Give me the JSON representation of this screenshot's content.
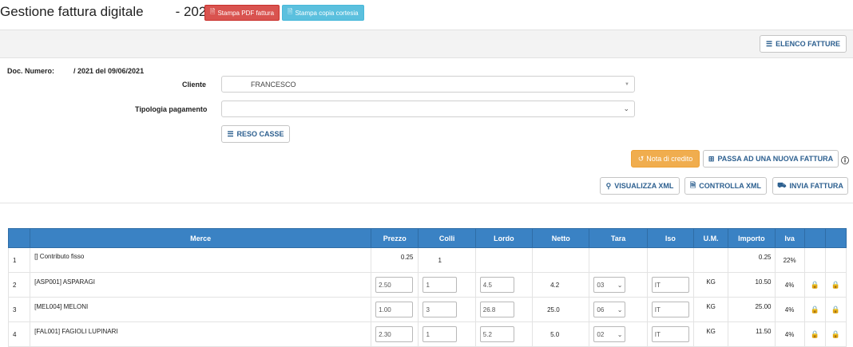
{
  "header": {
    "title": "Gestione fattura digitale",
    "year": "- 2021",
    "pdf_button": "Stampa PDF fattura",
    "copy_button": "Stampa copia cortesia"
  },
  "toolbar": {
    "list_button": "ELENCO FATTURE"
  },
  "form": {
    "doc_label": "Doc. Numero:",
    "doc_value": "/ 2021 del 09/06/2021",
    "cliente_label": "Cliente",
    "cliente_value": "FRANCESCO",
    "pagamento_label": "Tipologia pagamento",
    "pagamento_value": "",
    "reso_button": "RESO CASSE"
  },
  "actions": {
    "credit_note": "Nota di credito",
    "new_invoice": "PASSA AD UNA NUOVA FATTURA",
    "view_xml": "VISUALIZZA XML",
    "check_xml": "CONTROLLA XML",
    "send_invoice": "INVIA FATTURA"
  },
  "table": {
    "headers": [
      "",
      "Merce",
      "Prezzo",
      "Colli",
      "Lordo",
      "Netto",
      "Tara",
      "Iso",
      "U.M.",
      "Importo",
      "Iva",
      "",
      ""
    ],
    "rows": [
      {
        "n": "1",
        "merce": "[] Contributo fisso",
        "prezzo": "0.25",
        "colli": "1",
        "lordo": "",
        "netto": "",
        "tara": "",
        "iso": "",
        "um": "",
        "importo": "0.25",
        "iva": "22%"
      },
      {
        "n": "2",
        "merce": "[ASP001] ASPARAGI",
        "prezzo": "2.50",
        "colli": "1",
        "lordo": "4.5",
        "netto": "4.2",
        "tara": "03",
        "iso": "IT",
        "um": "KG",
        "importo": "10.50",
        "iva": "4%"
      },
      {
        "n": "3",
        "merce": "[MEL004] MELONI",
        "prezzo": "1.00",
        "colli": "3",
        "lordo": "26.8",
        "netto": "25.0",
        "tara": "06",
        "iso": "IT",
        "um": "KG",
        "importo": "25.00",
        "iva": "4%"
      },
      {
        "n": "4",
        "merce": "[FAL001] FAGIOLI LUPINARI",
        "prezzo": "2.30",
        "colli": "1",
        "lordo": "5.2",
        "netto": "5.0",
        "tara": "02",
        "iso": "IT",
        "um": "KG",
        "importo": "11.50",
        "iva": "4%"
      }
    ]
  },
  "colors": {
    "primary": "#3a82c4",
    "danger": "#d9534f",
    "info": "#5bc0de",
    "warning": "#f0ad4e",
    "link": "#2c5f8f"
  }
}
